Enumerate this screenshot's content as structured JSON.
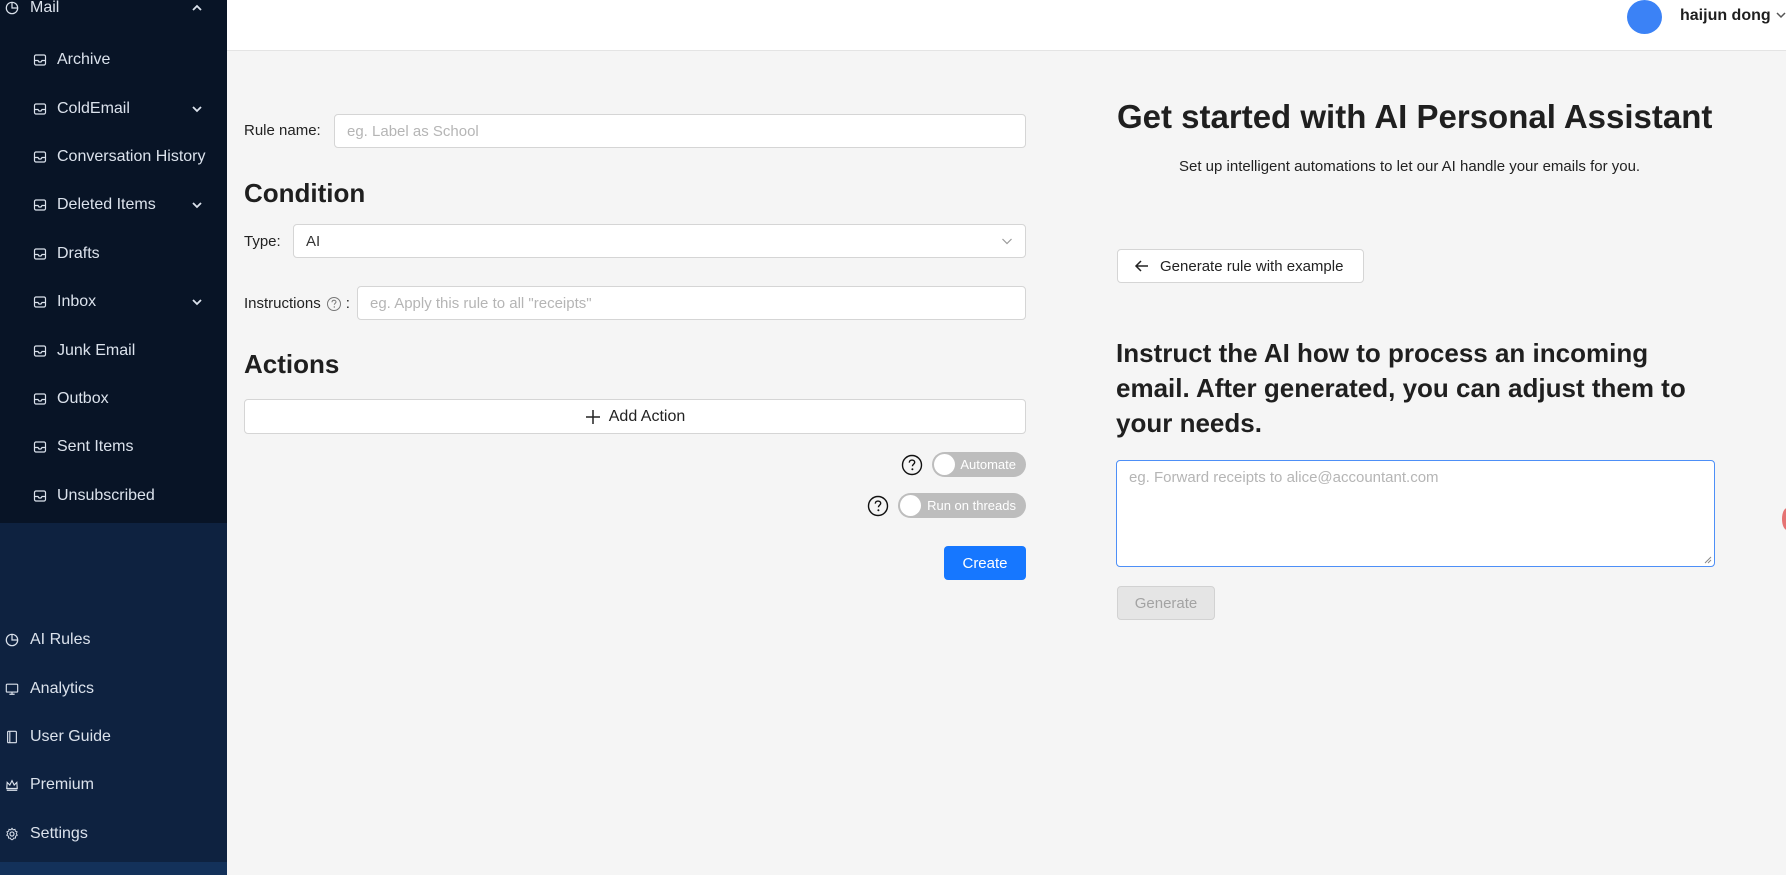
{
  "sidebar": {
    "mail": {
      "label": "Mail"
    },
    "mail_items": [
      {
        "label": "Archive",
        "has_children": false
      },
      {
        "label": "ColdEmail",
        "has_children": true
      },
      {
        "label": "Conversation History",
        "has_children": false
      },
      {
        "label": "Deleted Items",
        "has_children": true
      },
      {
        "label": "Drafts",
        "has_children": false
      },
      {
        "label": "Inbox",
        "has_children": true
      },
      {
        "label": "Junk Email",
        "has_children": false
      },
      {
        "label": "Outbox",
        "has_children": false
      },
      {
        "label": "Sent Items",
        "has_children": false
      },
      {
        "label": "Unsubscribed",
        "has_children": false
      }
    ],
    "bottom_items": [
      {
        "label": "AI Rules",
        "icon": "chart-pie-icon"
      },
      {
        "label": "Analytics",
        "icon": "monitor-icon"
      },
      {
        "label": "User Guide",
        "icon": "book-icon"
      },
      {
        "label": "Premium",
        "icon": "crown-icon"
      },
      {
        "label": "Settings",
        "icon": "gear-icon"
      }
    ]
  },
  "header": {
    "user_name": "haijun dong",
    "avatar_color": "#3b82f6"
  },
  "form": {
    "rule_name_label": "Rule name",
    "rule_name_placeholder": "eg. Label as School",
    "condition_heading": "Condition",
    "type_label": "Type",
    "type_value": "AI",
    "instructions_label": "Instructions",
    "instructions_placeholder": "eg. Apply this rule to all \"receipts\"",
    "actions_heading": "Actions",
    "add_action_label": "Add Action",
    "automate_label": "Automate",
    "automate_on": false,
    "run_on_threads_label": "Run on threads",
    "run_on_threads_on": false,
    "create_label": "Create"
  },
  "assistant": {
    "title": "Get started with AI Personal Assistant",
    "subtitle": "Set up intelligent automations to let our AI handle your emails for you.",
    "generate_example_label": "Generate rule with example",
    "instruct_heading": "Instruct the AI how to process an incoming email. After generated, you can adjust them to your needs.",
    "prompt_placeholder": "eg. Forward receipts to alice@accountant.com",
    "generate_label": "Generate"
  },
  "colors": {
    "sidebar_bg": "#0e2240",
    "sidebar_mail_bg": "#081426",
    "primary": "#1677ff"
  }
}
